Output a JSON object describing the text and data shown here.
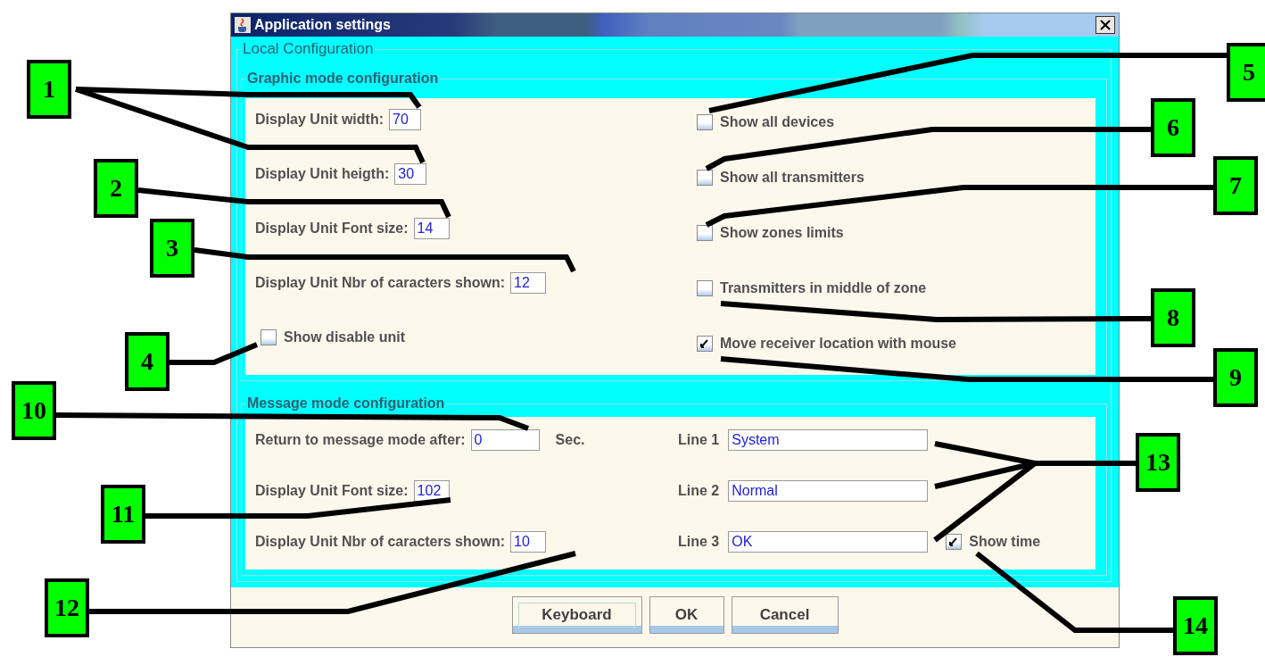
{
  "window": {
    "title": "Application settings"
  },
  "local_configuration": {
    "title": "Local Configuration",
    "graphic_mode": {
      "title": "Graphic mode configuration",
      "fields": [
        {
          "label": "Display Unit width:",
          "value": "70"
        },
        {
          "label": "Display Unit heigth:",
          "value": "30"
        },
        {
          "label": "Display Unit Font size:",
          "value": "14"
        },
        {
          "label": "Display Unit Nbr of caracters shown:",
          "value": "12"
        }
      ],
      "show_disable_unit": {
        "label": "Show disable unit",
        "checked": false
      },
      "options": [
        {
          "label": "Show all devices",
          "checked": false
        },
        {
          "label": "Show all transmitters",
          "checked": false
        },
        {
          "label": "Show zones limits",
          "checked": false
        },
        {
          "label": "Transmitters in middle of zone",
          "checked": false
        },
        {
          "label": "Move receiver location with mouse",
          "checked": true
        }
      ]
    },
    "message_mode": {
      "title": "Message mode configuration",
      "fields": [
        {
          "label": "Return to message mode after:",
          "value": "0",
          "unit": "Sec."
        },
        {
          "label": "Display Unit Font size:",
          "value": "102"
        },
        {
          "label": "Display Unit Nbr of caracters shown:",
          "value": "10"
        }
      ],
      "lines": [
        {
          "label": "Line 1",
          "value": "System"
        },
        {
          "label": "Line 2",
          "value": "Normal"
        },
        {
          "label": "Line 3",
          "value": "OK"
        }
      ],
      "show_time": {
        "label": "Show time",
        "checked": true
      }
    }
  },
  "buttons": [
    {
      "label": "Keyboard",
      "focused": true
    },
    {
      "label": "OK",
      "focused": false
    },
    {
      "label": "Cancel",
      "focused": false
    }
  ],
  "callouts": [
    {
      "number": "1"
    },
    {
      "number": "2"
    },
    {
      "number": "3"
    },
    {
      "number": "4"
    },
    {
      "number": "5"
    },
    {
      "number": "6"
    },
    {
      "number": "7"
    },
    {
      "number": "8"
    },
    {
      "number": "9"
    },
    {
      "number": "10"
    },
    {
      "number": "11"
    },
    {
      "number": "12"
    },
    {
      "number": "13"
    },
    {
      "number": "14"
    }
  ]
}
